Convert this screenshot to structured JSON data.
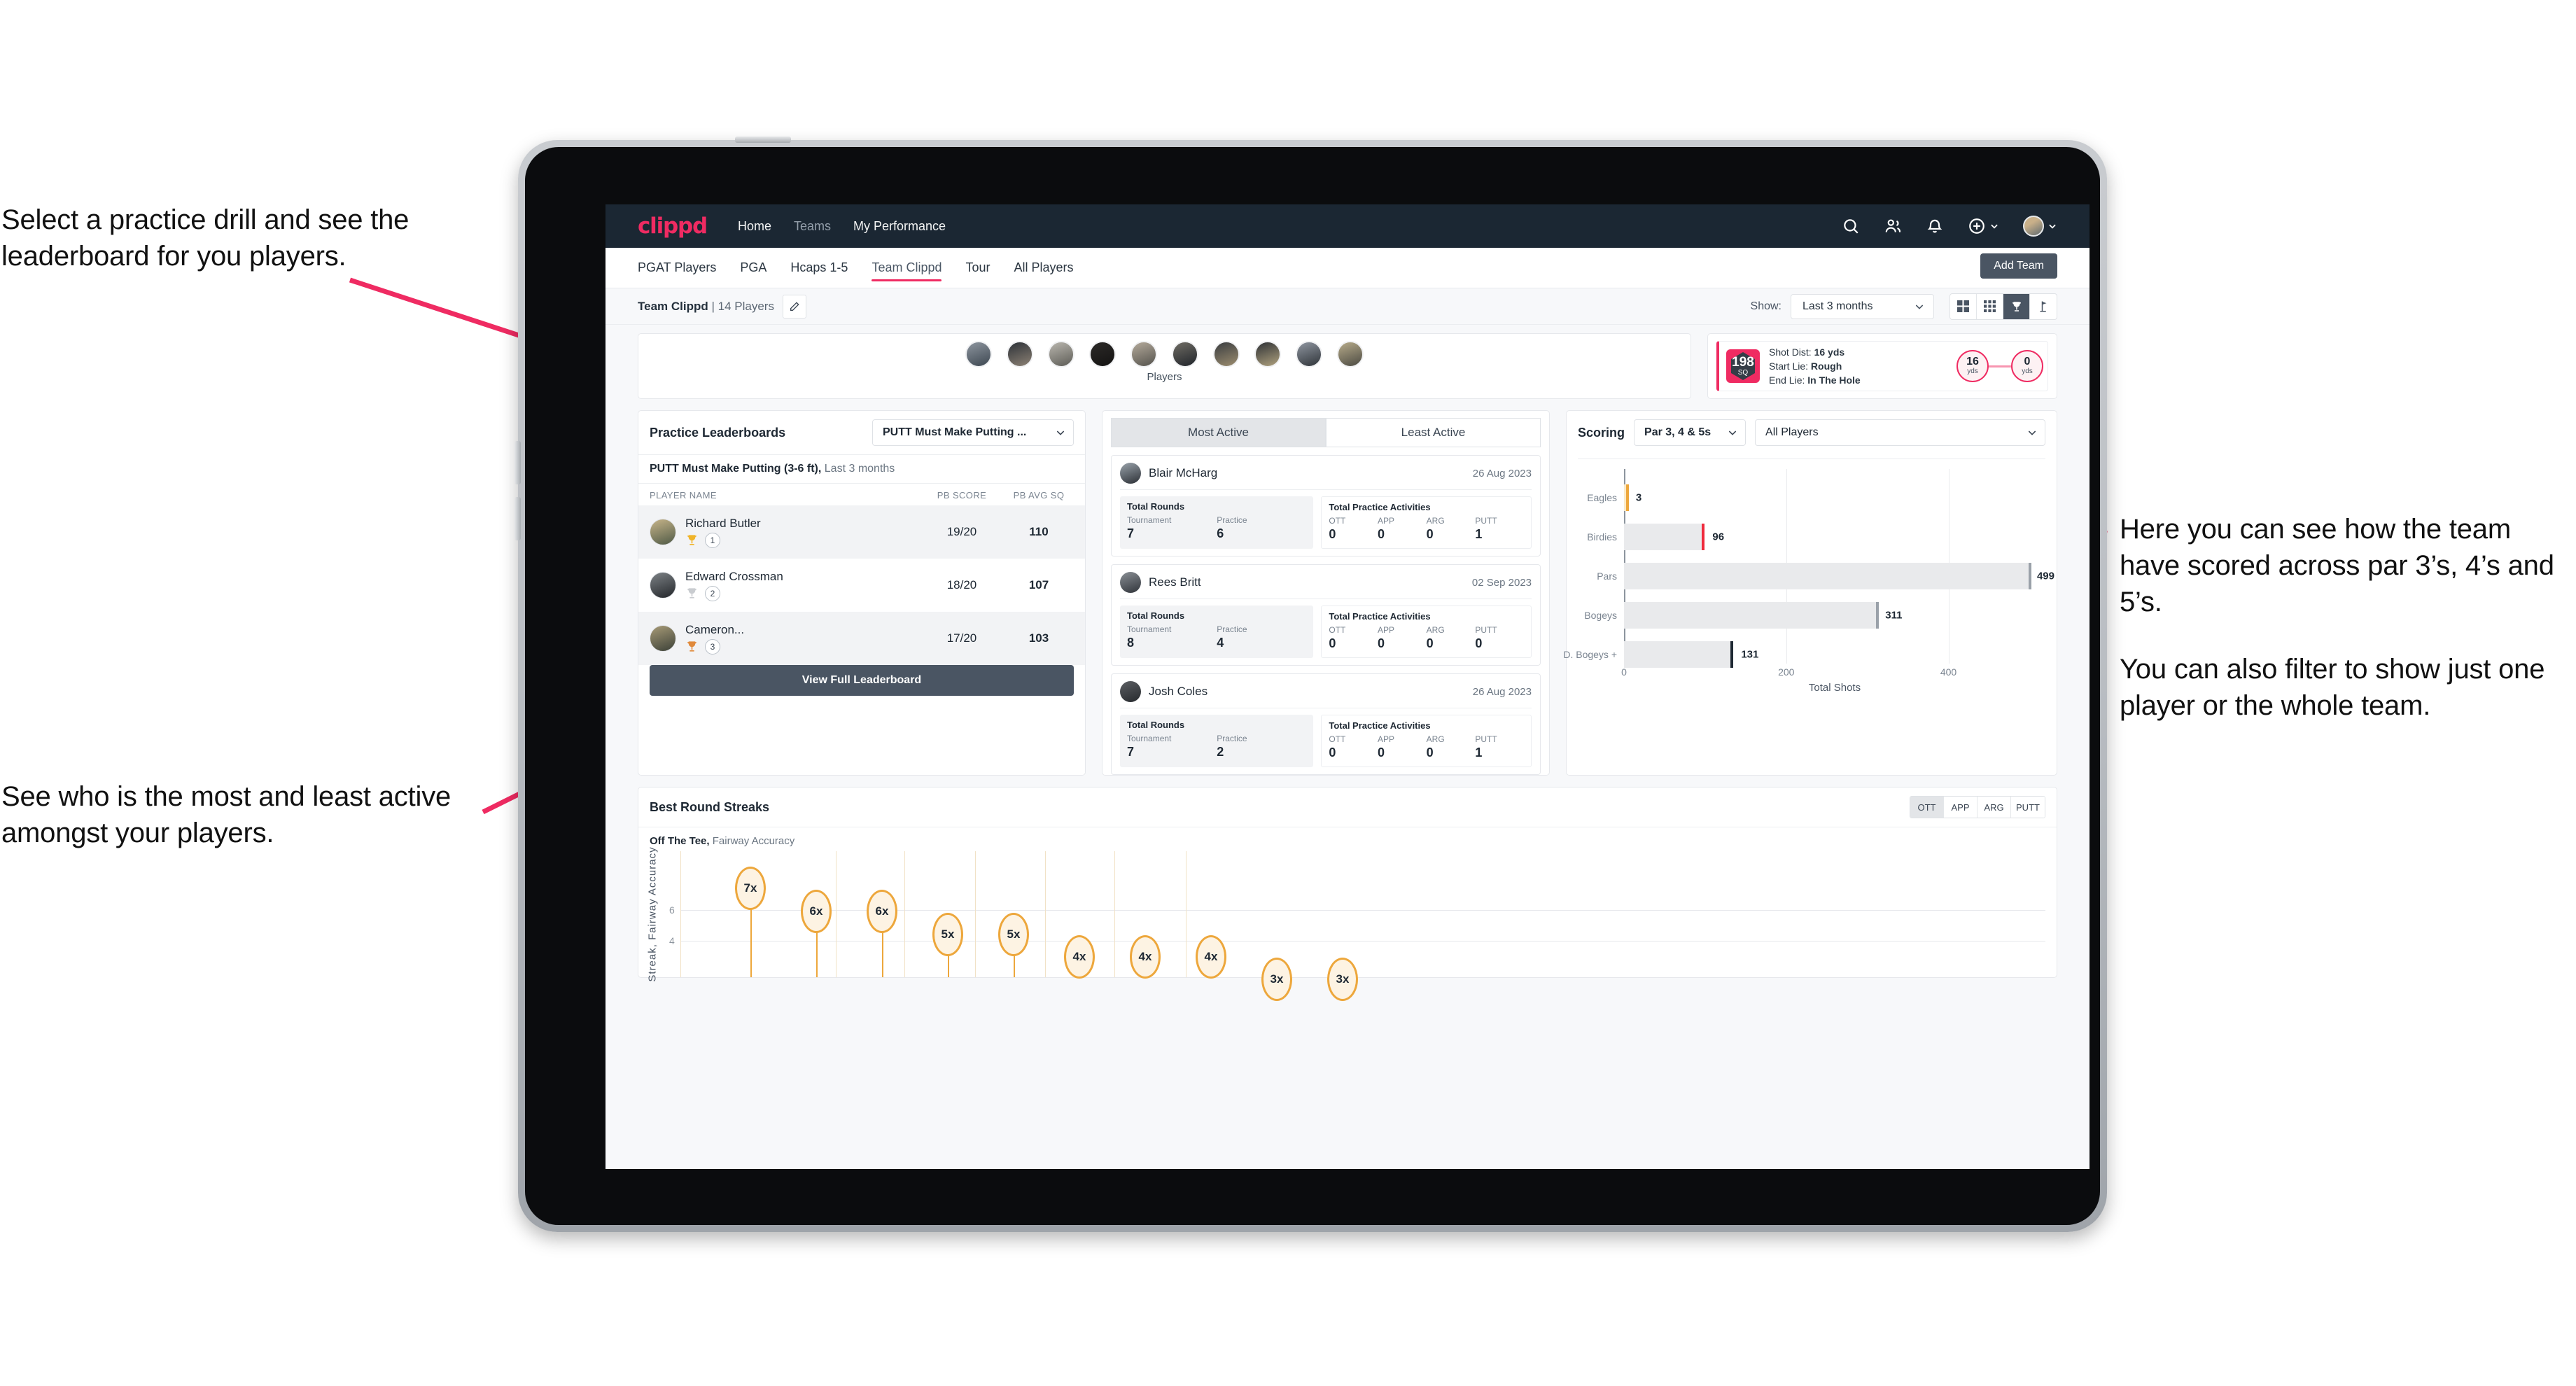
{
  "annotations": {
    "top_left": "Select a practice drill and see the leaderboard for you players.",
    "bottom_left": "See who is the most and least active amongst your players.",
    "right_1": "Here you can see how the team have scored across par 3’s, 4’s and 5’s.",
    "right_2": "You can also filter to show just one player or the whole team."
  },
  "colors": {
    "brand_pink": "#ef2b62",
    "nav_dark": "#1b2733",
    "button_slate": "#4a5563",
    "gold": "#eda73c",
    "bar_grey": "#e9eaec"
  },
  "topnav": {
    "logo": "clippd",
    "links": [
      {
        "label": "Home",
        "active": true
      },
      {
        "label": "Teams",
        "active": false
      },
      {
        "label": "My Performance",
        "active": true
      }
    ],
    "icons": [
      "search-icon",
      "people-icon",
      "bell-icon",
      "plus-circle-icon",
      "avatar"
    ]
  },
  "tabs": {
    "items": [
      "PGAT Players",
      "PGA",
      "Hcaps 1-5",
      "Team Clippd",
      "Tour",
      "All Players"
    ],
    "active": "Team Clippd",
    "add_team_button": "Add Team"
  },
  "subbar": {
    "team_name": "Team Clippd",
    "team_separator": "|",
    "team_players": "14 Players",
    "edit_icon": "pencil-icon",
    "show_label": "Show:",
    "range_value": "Last 3 months",
    "view_toggles": [
      {
        "name": "grid-large-icon",
        "active": false
      },
      {
        "name": "grid-small-icon",
        "active": false
      },
      {
        "name": "trophy-icon",
        "active": true
      },
      {
        "name": "flag-icon",
        "active": false
      }
    ]
  },
  "players_card": {
    "caption": "Players",
    "count": 10
  },
  "shot_card": {
    "sq_value": "198",
    "sq_label": "SQ",
    "lines": [
      {
        "label": "Shot Dist:",
        "value": "16 yds"
      },
      {
        "label": "Start Lie:",
        "value": "Rough"
      },
      {
        "label": "End Lie:",
        "value": "In The Hole"
      }
    ],
    "start_dot": {
      "value": "16",
      "unit": "yds"
    },
    "end_dot": {
      "value": "0",
      "unit": "yds"
    }
  },
  "leaderboard": {
    "title": "Practice Leaderboards",
    "drill_select": "PUTT Must Make Putting ...",
    "subtitle_bold": "PUTT Must Make Putting (3-6 ft),",
    "subtitle_muted": "Last 3 months",
    "columns": [
      "PLAYER NAME",
      "PB SCORE",
      "PB AVG SQ"
    ],
    "rows": [
      {
        "name": "Richard Butler",
        "rank": "1",
        "trophy": "gold",
        "score": "19/20",
        "sq": "110"
      },
      {
        "name": "Edward Crossman",
        "rank": "2",
        "trophy": "silver",
        "score": "18/20",
        "sq": "107"
      },
      {
        "name": "Cameron...",
        "rank": "3",
        "trophy": "bronze",
        "score": "17/20",
        "sq": "103"
      }
    ],
    "button": "View Full Leaderboard"
  },
  "activity": {
    "tabs": [
      {
        "label": "Most Active",
        "active": true
      },
      {
        "label": "Least Active",
        "active": false
      }
    ],
    "rounds_header": "Total Rounds",
    "rounds_cols": [
      "Tournament",
      "Practice"
    ],
    "practice_header": "Total Practice Activities",
    "practice_cols": [
      "OTT",
      "APP",
      "ARG",
      "PUTT"
    ],
    "cards": [
      {
        "name": "Blair McHarg",
        "date": "26 Aug 2023",
        "tournament": "7",
        "practice": "6",
        "ott": "0",
        "app": "0",
        "arg": "0",
        "putt": "1"
      },
      {
        "name": "Rees Britt",
        "date": "02 Sep 2023",
        "tournament": "8",
        "practice": "4",
        "ott": "0",
        "app": "0",
        "arg": "0",
        "putt": "0"
      },
      {
        "name": "Josh Coles",
        "date": "26 Aug 2023",
        "tournament": "7",
        "practice": "2",
        "ott": "0",
        "app": "0",
        "arg": "0",
        "putt": "1"
      }
    ]
  },
  "scoring": {
    "title": "Scoring",
    "par_select": "Par 3, 4 & 5s",
    "player_select": "All Players"
  },
  "streaks": {
    "title": "Best Round Streaks",
    "toggles": [
      {
        "label": "OTT",
        "active": true
      },
      {
        "label": "APP",
        "active": false
      },
      {
        "label": "ARG",
        "active": false
      },
      {
        "label": "PUTT",
        "active": false
      }
    ],
    "subtitle_bold": "Off The Tee,",
    "subtitle_muted": "Fairway Accuracy"
  },
  "chart_data": [
    {
      "type": "bar",
      "orientation": "horizontal",
      "title": "Scoring",
      "categories": [
        "Eagles",
        "Birdies",
        "Pars",
        "Bogeys",
        "D. Bogeys +"
      ],
      "values": [
        3,
        96,
        499,
        311,
        131
      ],
      "cap_colors": [
        "#eda73c",
        "#ef2b3c",
        "#9aa1a9",
        "#9aa1a9",
        "#1e2833"
      ],
      "xlabel": "Total Shots",
      "ylabel": "",
      "xlim": [
        0,
        520
      ],
      "xticks": [
        0,
        200,
        400
      ],
      "grid": true,
      "legend": "none"
    },
    {
      "type": "scatter",
      "subtype": "lollipop",
      "title": "Best Round Streaks",
      "series_name": "Off The Tee, Fairway Accuracy",
      "ylabel": "Streak, Fairway Accuracy",
      "ylim": [
        0,
        8
      ],
      "yticks": [
        4,
        6
      ],
      "grid": true,
      "values": [
        7,
        6,
        6,
        5,
        5,
        4,
        4,
        4,
        3,
        3
      ],
      "labels": [
        "7x",
        "6x",
        "6x",
        "5x",
        "5x",
        "4x",
        "4x",
        "4x",
        "3x",
        "3x"
      ]
    }
  ]
}
